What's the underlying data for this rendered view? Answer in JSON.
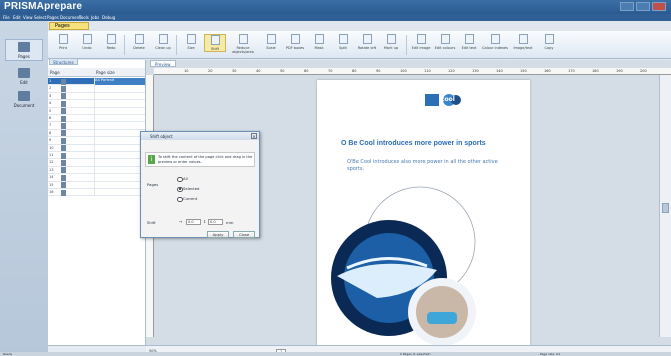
{
  "app": {
    "title": "PRISMAprepare"
  },
  "menu": [
    "File",
    "Edit",
    "View",
    "Select",
    "Pages",
    "Document",
    "Tools",
    "Jobs",
    "Debug"
  ],
  "ribbon": {
    "active_tab": "Pages"
  },
  "modes": [
    {
      "label": "Pages"
    },
    {
      "label": "Edit"
    },
    {
      "label": "Document"
    }
  ],
  "toolbar": {
    "buttons": [
      "Print",
      "Undo",
      "Redo",
      "Delete",
      "Clean up",
      "Size",
      "Shift",
      "Reduce objects/area",
      "Scale",
      "PDF boxes",
      "Mask",
      "Split",
      "Rotate left",
      "Mark up",
      "Edit image",
      "Edit colours",
      "Edit text",
      "Colour indexes",
      "Image/text",
      "Copy"
    ],
    "selected": "Shift"
  },
  "left_panel": {
    "tabs": [
      "Structures"
    ],
    "columns": {
      "page": "Page",
      "size": "Page size"
    },
    "rows": [
      "1",
      "2",
      "3",
      "4",
      "5",
      "6",
      "7",
      "8",
      "9",
      "10",
      "11",
      "12",
      "13",
      "14",
      "15",
      "16"
    ],
    "selected_row": "1",
    "selected_size": "A4 Portrait"
  },
  "preview": {
    "tab": "Preview",
    "ruler": [
      "10",
      "20",
      "30",
      "40",
      "50",
      "60",
      "70",
      "80",
      "90",
      "100",
      "110",
      "120",
      "130",
      "140",
      "150",
      "160",
      "170",
      "180",
      "190",
      "200"
    ],
    "zoom": "50%",
    "page_counter": "1"
  },
  "page_content": {
    "logo": "cool",
    "headline": "O Be Cool introduces more power in sports",
    "bullet": "O'Be Cool introduces also more power in all the other active sports."
  },
  "dialog": {
    "title": "Shift object",
    "info": "To shift the content of the page click and drag in the preview or enter values.",
    "pages_label": "Pages",
    "options": [
      "All",
      "Selected",
      "Current"
    ],
    "selected_option": "Selected",
    "shift_label": "Shift",
    "x_value": "0.0",
    "y_value": "0.0",
    "unit": "mm",
    "apply": "Apply",
    "close": "Close"
  },
  "status": {
    "left": "Ready",
    "middle": "0 Pages (1 selected)",
    "right": "Page size: A4"
  },
  "colors": {
    "accent": "#2b6fb7",
    "selected_row": "#2f6fb7"
  }
}
